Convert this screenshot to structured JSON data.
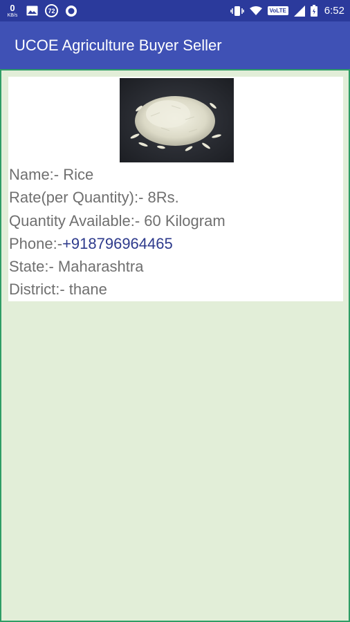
{
  "status_bar": {
    "net_speed_value": "0",
    "net_speed_unit": "KB/s",
    "notification_count": "72",
    "network_badge": "VoLTE",
    "time": "6:52"
  },
  "app_bar": {
    "title": "UCOE Agriculture Buyer Seller"
  },
  "product": {
    "name_label": "Name:- ",
    "name_value": "Rice",
    "rate_label": "Rate(per Quantity):- ",
    "rate_value": "8Rs.",
    "quantity_label": "Quantity Available:- ",
    "quantity_value": "60 Kilogram",
    "phone_label": "Phone:-",
    "phone_value": "+918796964465",
    "state_label": "State:- ",
    "state_value": "Maharashtra",
    "district_label": "District:- ",
    "district_value": "thane",
    "image_icon": "rice-grain-photo"
  },
  "colors": {
    "status_bar": "#2b3a9c",
    "app_bar": "#3f51b5",
    "content_bg": "#e2eed8",
    "content_border": "#2e9d65",
    "text": "#6f6f6f",
    "phone_link": "#2d3a8c"
  }
}
